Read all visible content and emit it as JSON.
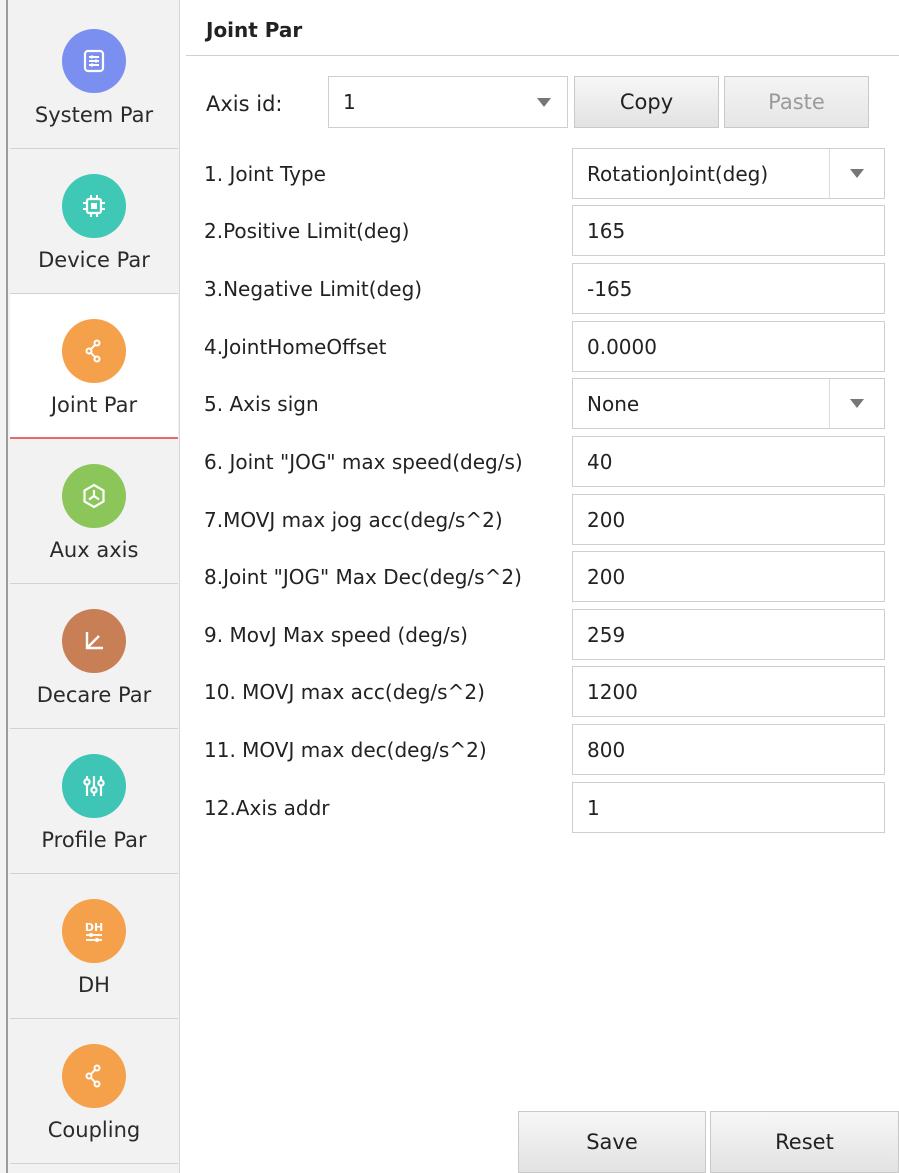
{
  "sidebar": {
    "items": [
      {
        "label": "System Par",
        "icon": "settings-list-icon",
        "color": "#7b8ff0"
      },
      {
        "label": "Device Par",
        "icon": "chip-icon",
        "color": "#3fc8b5"
      },
      {
        "label": "Joint Par",
        "icon": "joint-icon",
        "color": "#f5a04a",
        "active": true
      },
      {
        "label": "Aux axis",
        "icon": "aux-axis-icon",
        "color": "#8cc65a"
      },
      {
        "label": "Decare Par",
        "icon": "axes-icon",
        "color": "#c97f55"
      },
      {
        "label": "Profile Par",
        "icon": "sliders-icon",
        "color": "#3ec5b5"
      },
      {
        "label": "DH",
        "icon": "dh-icon",
        "color": "#f5a04a"
      },
      {
        "label": "Coupling",
        "icon": "coupling-icon",
        "color": "#f5a04a"
      }
    ]
  },
  "header": {
    "title": "Joint Par"
  },
  "axis": {
    "label": "Axis id:",
    "value": "1",
    "copy_label": "Copy",
    "paste_label": "Paste"
  },
  "params": [
    {
      "label": "1. Joint Type",
      "value": "RotationJoint(deg)",
      "dropdown": true
    },
    {
      "label": "2.Positive Limit(deg)",
      "value": "165"
    },
    {
      "label": "3.Negative Limit(deg)",
      "value": "-165"
    },
    {
      "label": "4.JointHomeOffset",
      "value": "0.0000"
    },
    {
      "label": "5. Axis sign",
      "value": "None",
      "dropdown": true
    },
    {
      "label": "6. Joint \"JOG\" max speed(deg/s)",
      "value": "40"
    },
    {
      "label": "7.MOVJ max jog acc(deg/s^2)",
      "value": "200"
    },
    {
      "label": "8.Joint \"JOG\" Max Dec(deg/s^2)",
      "value": "200"
    },
    {
      "label": "9. MovJ Max speed (deg/s)",
      "value": "259"
    },
    {
      "label": "10. MOVJ max acc(deg/s^2)",
      "value": "1200"
    },
    {
      "label": "11. MOVJ max dec(deg/s^2)",
      "value": "800"
    },
    {
      "label": "12.Axis addr",
      "value": "1"
    }
  ],
  "footer": {
    "save_label": "Save",
    "reset_label": "Reset"
  }
}
